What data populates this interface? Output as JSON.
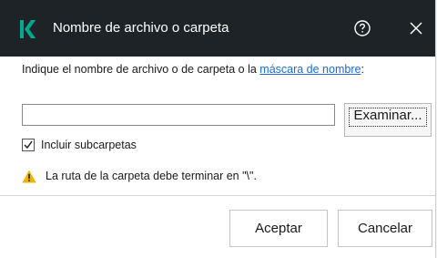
{
  "dialog": {
    "title": "Nombre de archivo o carpeta",
    "logo_icon": "kaspersky-k-logo",
    "help_icon": "help-circle-icon",
    "close_icon": "close-icon"
  },
  "instruction": {
    "text_before": "Indique el nombre de archivo o de carpeta o la ",
    "link_text": "máscara de nombre",
    "text_after": ":"
  },
  "path_field": {
    "value": "",
    "placeholder": ""
  },
  "browse_button": {
    "label": "Examinar..."
  },
  "include_subfolders": {
    "label": "Incluir subcarpetas",
    "checked": true
  },
  "warning": {
    "icon": "warning-triangle-icon",
    "text": "La ruta de la carpeta debe terminar en \"\\\"."
  },
  "buttons": {
    "ok": "Aceptar",
    "cancel": "Cancelar"
  },
  "colors": {
    "titlebar": "#1e2327",
    "brand_green": "#00a88e",
    "link": "#1a6bd6",
    "warning": "#f2b200"
  }
}
